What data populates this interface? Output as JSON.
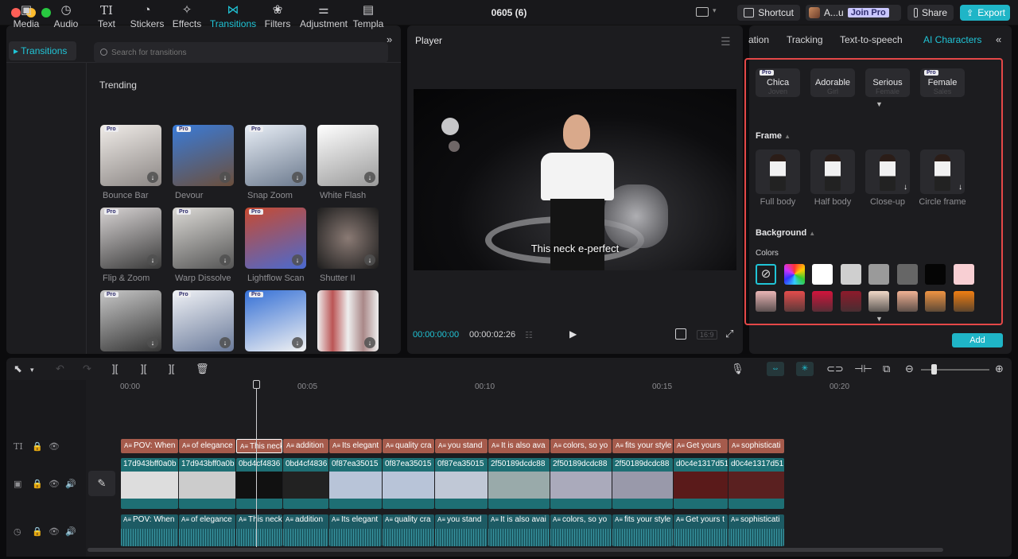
{
  "window": {
    "title": "0605 (6)"
  },
  "titlebar": {
    "shortcut_label": "Shortcut",
    "user_label": "A...u",
    "join_pro_label": "Join Pro",
    "share_label": "Share",
    "export_label": "Export"
  },
  "toolbar": {
    "items": [
      {
        "label": "Media",
        "icon": "media-icon"
      },
      {
        "label": "Audio",
        "icon": "audio-icon"
      },
      {
        "label": "Text",
        "icon": "text-icon"
      },
      {
        "label": "Stickers",
        "icon": "stickers-icon"
      },
      {
        "label": "Effects",
        "icon": "effects-icon"
      },
      {
        "label": "Transitions",
        "icon": "transitions-icon"
      },
      {
        "label": "Filters",
        "icon": "filters-icon"
      },
      {
        "label": "Adjustment",
        "icon": "adjustment-icon"
      },
      {
        "label": "Templa",
        "icon": "templates-icon"
      }
    ],
    "active": "Transitions"
  },
  "sidebar": {
    "active_item": "Transitions"
  },
  "search": {
    "placeholder": "Search for transitions"
  },
  "transitions": {
    "section_title": "Trending",
    "items": [
      {
        "label": "Bounce Bar",
        "pro": "Pro"
      },
      {
        "label": "Devour",
        "pro": "Pro"
      },
      {
        "label": "Snap Zoom",
        "pro": "Pro"
      },
      {
        "label": "White Flash",
        "pro": ""
      },
      {
        "label": "Flip & Zoom",
        "pro": "Pro"
      },
      {
        "label": "Warp Dissolve",
        "pro": "Pro"
      },
      {
        "label": "Lightflow Scan",
        "pro": "Pro"
      },
      {
        "label": "Shutter II",
        "pro": ""
      },
      {
        "label": "",
        "pro": "Pro"
      },
      {
        "label": "",
        "pro": "Pro"
      },
      {
        "label": "",
        "pro": "Pro"
      },
      {
        "label": "",
        "pro": ""
      }
    ]
  },
  "player": {
    "title": "Player",
    "caption": "This neck          e-perfect",
    "time_current": "00:00:00:00",
    "time_total": "00:00:02:26",
    "ratio": "16:9"
  },
  "right_panel": {
    "tabs": [
      "ation",
      "Tracking",
      "Text-to-speech",
      "AI Characters"
    ],
    "active_tab": "AI Characters",
    "voices": [
      {
        "name": "Chica",
        "sub": "Joven",
        "pro": "Pro"
      },
      {
        "name": "Adorable",
        "sub": "Girl",
        "pro": ""
      },
      {
        "name": "Serious",
        "sub": "Female",
        "pro": ""
      },
      {
        "name": "Female",
        "sub": "Sales",
        "pro": "Pro"
      }
    ],
    "frame_heading": "Frame",
    "frames": [
      "Full body",
      "Half body",
      "Close-up",
      "Circle frame"
    ],
    "background_heading": "Background",
    "colors_label": "Colors",
    "swatches_row1": [
      "none",
      "rainbow",
      "#ffffff",
      "#cfcfcf",
      "#9a9a9a",
      "#666666",
      "#050505",
      "#f8cfd3"
    ],
    "swatches_row2": [
      "#e9b5b5",
      "#e44c4c",
      "#d2143c",
      "#8e1a2b",
      "#f1d9c8",
      "#f1b193",
      "#ef9443",
      "#f07e12"
    ],
    "add_label": "Add"
  },
  "timeline": {
    "ruler": [
      "00:00",
      "00:05",
      "00:10",
      "00:15",
      "00:20"
    ],
    "text_clips": [
      "POV: When",
      "of elegance",
      "This neck",
      "addition",
      "Its elegant",
      "quality cra",
      "you stand",
      "It is also ava",
      "colors, so yo",
      "fits your style",
      "Get yours",
      "sophisticati"
    ],
    "video_clips": [
      "17d943bff0a0b",
      "17d943bff0a0b",
      "0bd4cf4836",
      "0bd4cf4836",
      "0f87ea35015",
      "0f87ea35015",
      "0f87ea35015",
      "2f50189dcdc88",
      "2f50189dcdc88",
      "2f50189dcdc88",
      "d0c4e1317d51",
      "d0c4e1317d51"
    ],
    "audio_clips": [
      "POV: When",
      "of elegance",
      "This neck",
      "addition",
      "Its elegant",
      "quality cra",
      "you stand",
      "It is also avai",
      "colors, so yo",
      "fits your style",
      "Get yours t",
      "sophisticati"
    ]
  },
  "colors": {
    "accent": "#20c4d6",
    "highlight_border": "#e54848",
    "text_clip": "#a65b4c",
    "video_clip": "#1e6f74"
  }
}
